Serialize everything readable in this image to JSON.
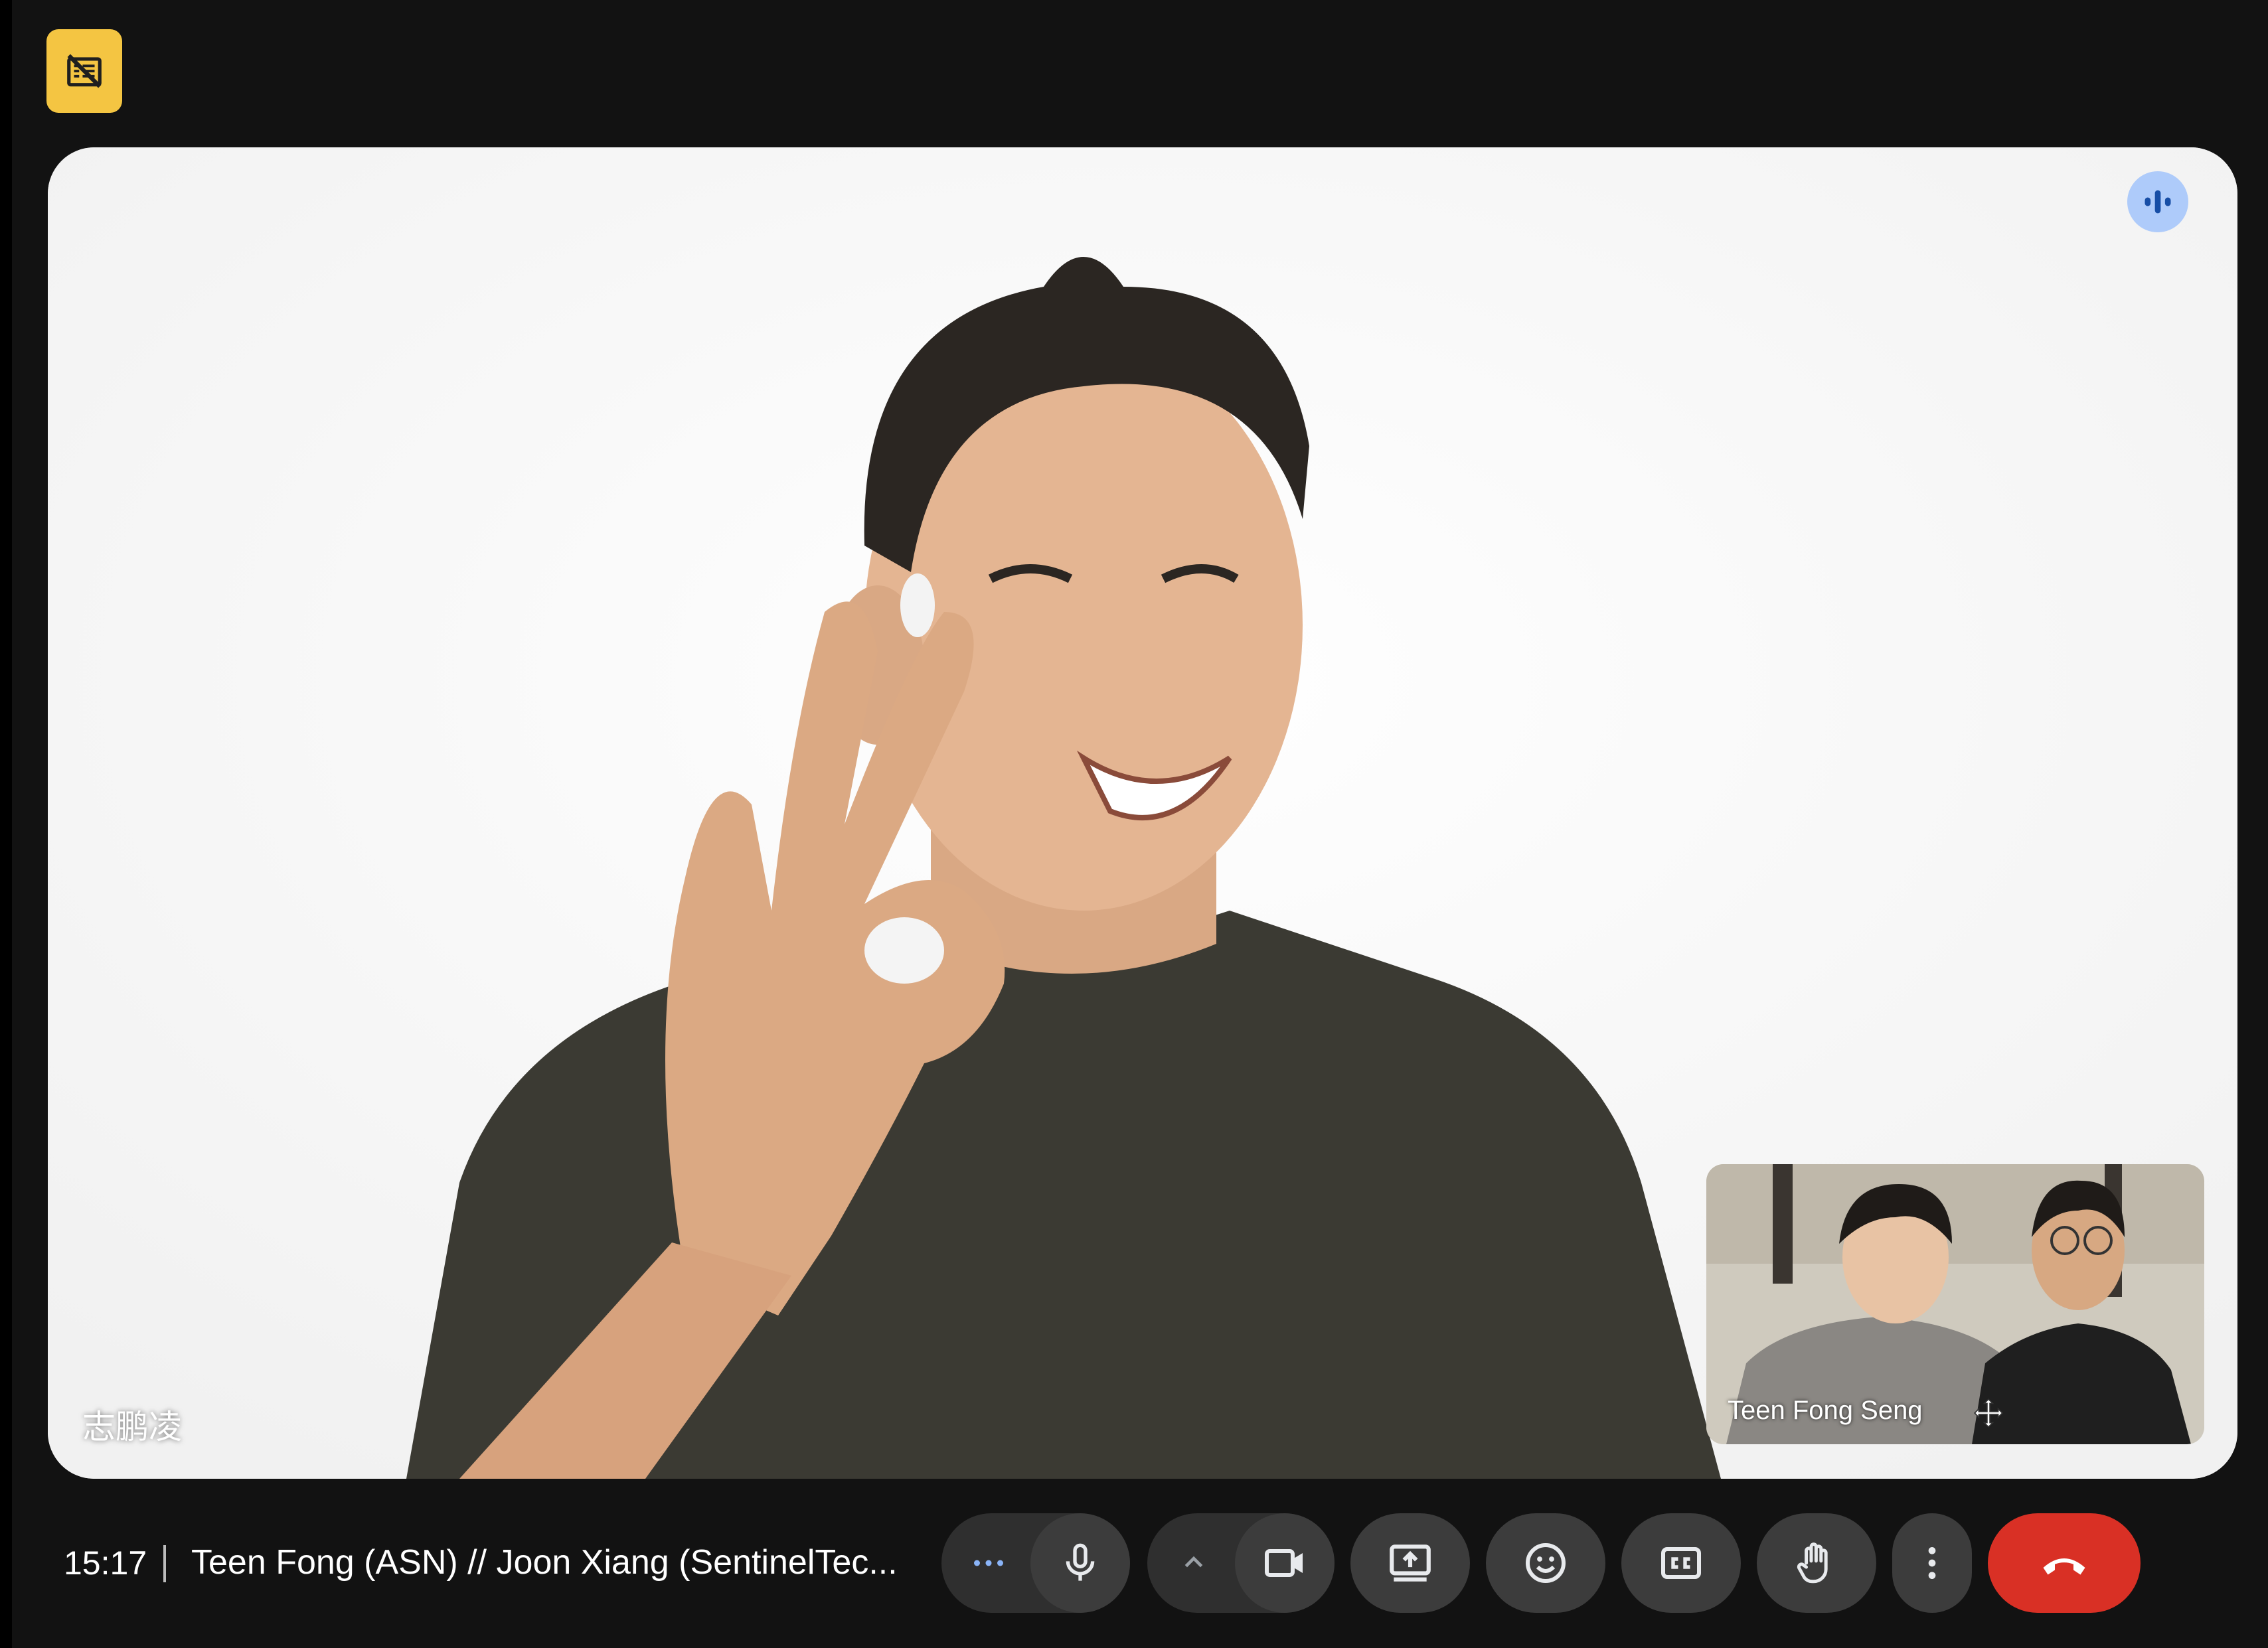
{
  "badge": {
    "icon": "no-recording-icon"
  },
  "main_tile": {
    "participant_name": "志鹏凌",
    "indicator_icon": "audio-activity-icon"
  },
  "self_view": {
    "participant_name": "Teen Fong Seng",
    "move_icon": "move-icon"
  },
  "bottom_bar": {
    "time": "15:17",
    "meeting_title": "Teen Fong (ASN) // Joon Xiang (SentinelTec...",
    "controls": [
      {
        "name": "more-audio-options",
        "icon": "ellipsis-icon"
      },
      {
        "name": "microphone",
        "icon": "mic-icon"
      },
      {
        "name": "video-options",
        "icon": "chevron-up-icon"
      },
      {
        "name": "camera",
        "icon": "video-camera-icon"
      },
      {
        "name": "present",
        "icon": "present-screen-icon"
      },
      {
        "name": "reactions",
        "icon": "emoji-icon"
      },
      {
        "name": "captions",
        "icon": "closed-captions-icon"
      },
      {
        "name": "raise-hand",
        "icon": "hand-icon"
      },
      {
        "name": "more-options",
        "icon": "vertical-dots-icon"
      },
      {
        "name": "leave-call",
        "icon": "end-call-icon"
      }
    ],
    "colors": {
      "end_call": "#d93025",
      "button": "#3c3c3c",
      "badge": "#f4c542",
      "indicator": "#aecbfa"
    }
  }
}
